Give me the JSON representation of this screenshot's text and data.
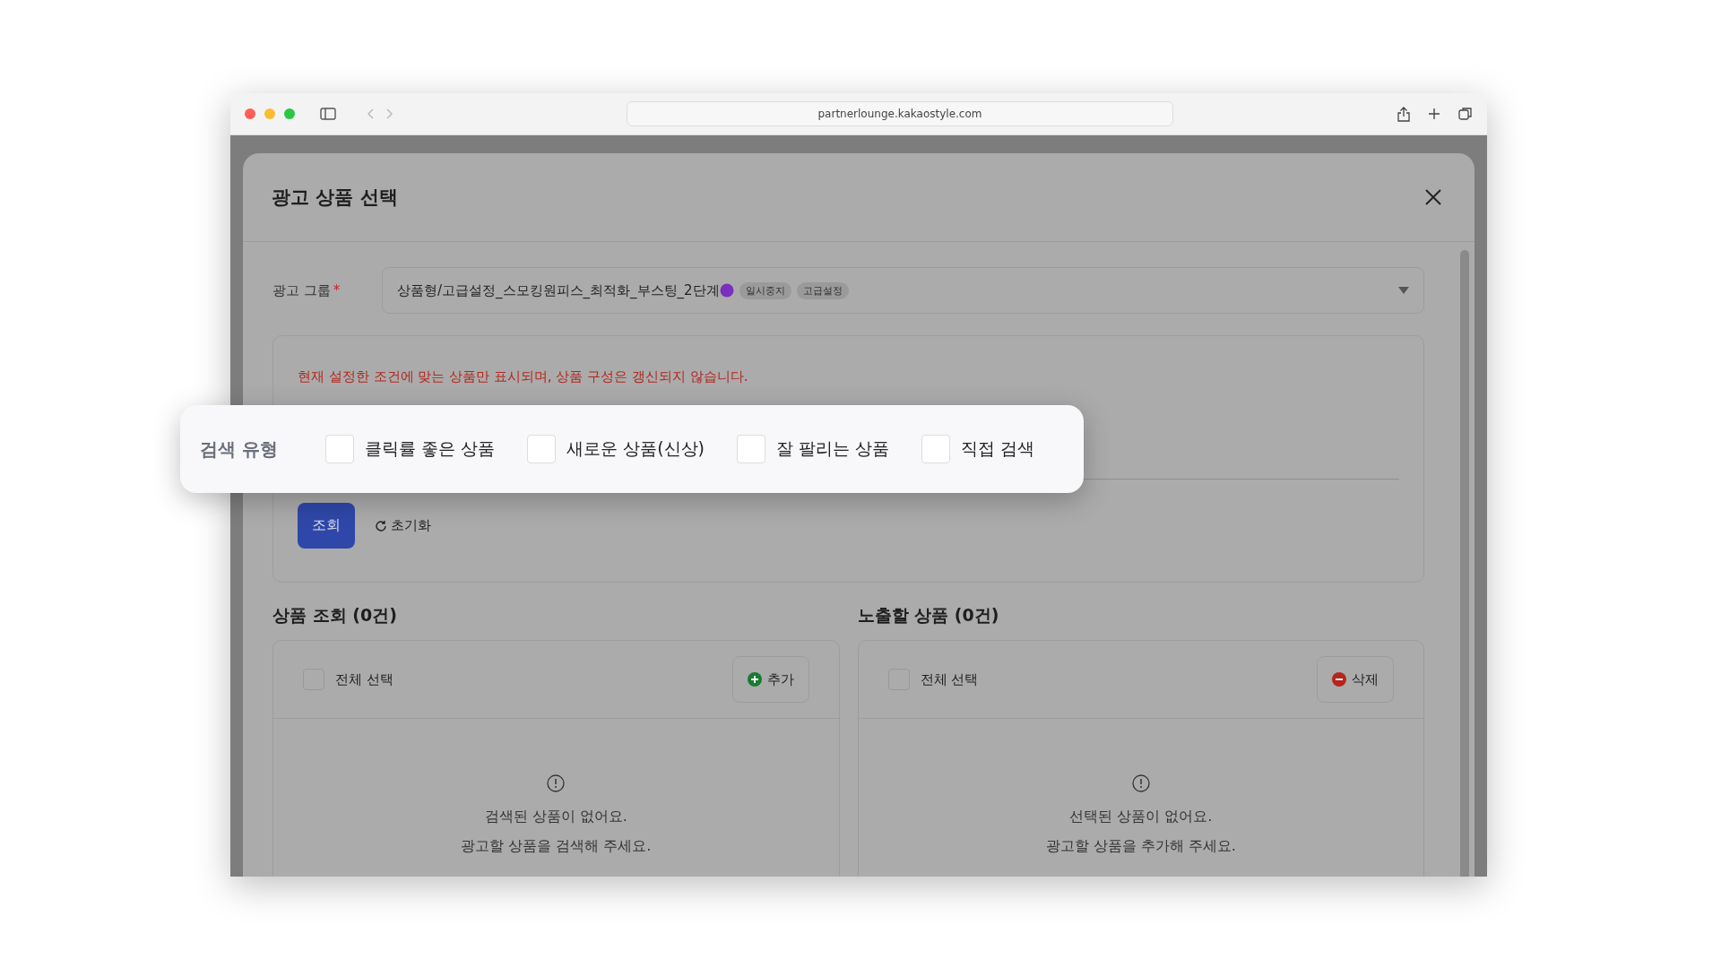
{
  "browser": {
    "url": "partnerlounge.kakaostyle.com"
  },
  "modal": {
    "title": "광고 상품 선택",
    "ad_group": {
      "label": "광고 그룹",
      "required_mark": "*",
      "value": "상품형/고급설정_스모킹원피스_최적화_부스팅_2단계",
      "tags": [
        "일시중지",
        "고급설정"
      ]
    },
    "notice": "현재 설정한 조건에 맞는 상품만 표시되며, 상품 구성은 갱신되지 않습니다.",
    "search_button": "조회",
    "reset_button": "초기화",
    "lists": [
      {
        "title": "상품 조회 (0건)",
        "select_all": {
          "label": "전체 선택",
          "checked": false
        },
        "action": {
          "kind": "add",
          "label": "추가"
        },
        "empty_lines": [
          "검색된 상품이 없어요.",
          "광고할 상품을 검색해 주세요."
        ]
      },
      {
        "title": "노출할 상품 (0건)",
        "select_all": {
          "label": "전체 선택",
          "checked": false
        },
        "action": {
          "kind": "delete",
          "label": "삭제"
        },
        "empty_lines": [
          "선택된 상품이 없어요.",
          "광고할 상품을 추가해 주세요."
        ]
      }
    ]
  },
  "callout": {
    "label": "검색 유형",
    "options": [
      {
        "label": "클릭률 좋은 상품",
        "checked": false
      },
      {
        "label": "새로운 상품(신상)",
        "checked": false
      },
      {
        "label": "잘 팔리는 상품",
        "checked": false
      },
      {
        "label": "직접 검색",
        "checked": false
      }
    ]
  }
}
